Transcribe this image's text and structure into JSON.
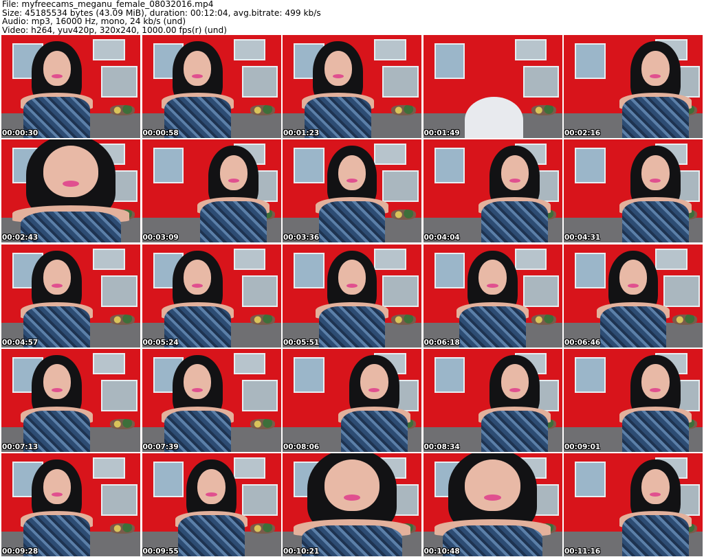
{
  "header": {
    "file": "File: myfreecams_meganu_female_08032016.mp4",
    "size": "Size: 45185534 bytes (43.09 MiB), duration: 00:12:04, avg.bitrate: 499 kb/s",
    "audio": "Audio: mp3, 16000 Hz, mono, 24 kb/s (und)",
    "video": "Video: h264, yuv420p, 320x240, 1000.00 fps(r) (und)"
  },
  "thumbnails": [
    {
      "time": "00:00:30"
    },
    {
      "time": "00:00:58"
    },
    {
      "time": "00:01:23"
    },
    {
      "time": "00:01:49"
    },
    {
      "time": "00:02:16"
    },
    {
      "time": "00:02:43"
    },
    {
      "time": "00:03:09"
    },
    {
      "time": "00:03:36"
    },
    {
      "time": "00:04:04"
    },
    {
      "time": "00:04:31"
    },
    {
      "time": "00:04:57"
    },
    {
      "time": "00:05:24"
    },
    {
      "time": "00:05:51"
    },
    {
      "time": "00:06:18"
    },
    {
      "time": "00:06:46"
    },
    {
      "time": "00:07:13"
    },
    {
      "time": "00:07:39"
    },
    {
      "time": "00:08:06"
    },
    {
      "time": "00:08:34"
    },
    {
      "time": "00:09:01"
    },
    {
      "time": "00:09:28"
    },
    {
      "time": "00:09:55"
    },
    {
      "time": "00:10:21"
    },
    {
      "time": "00:10:48"
    },
    {
      "time": "00:11:16"
    }
  ]
}
